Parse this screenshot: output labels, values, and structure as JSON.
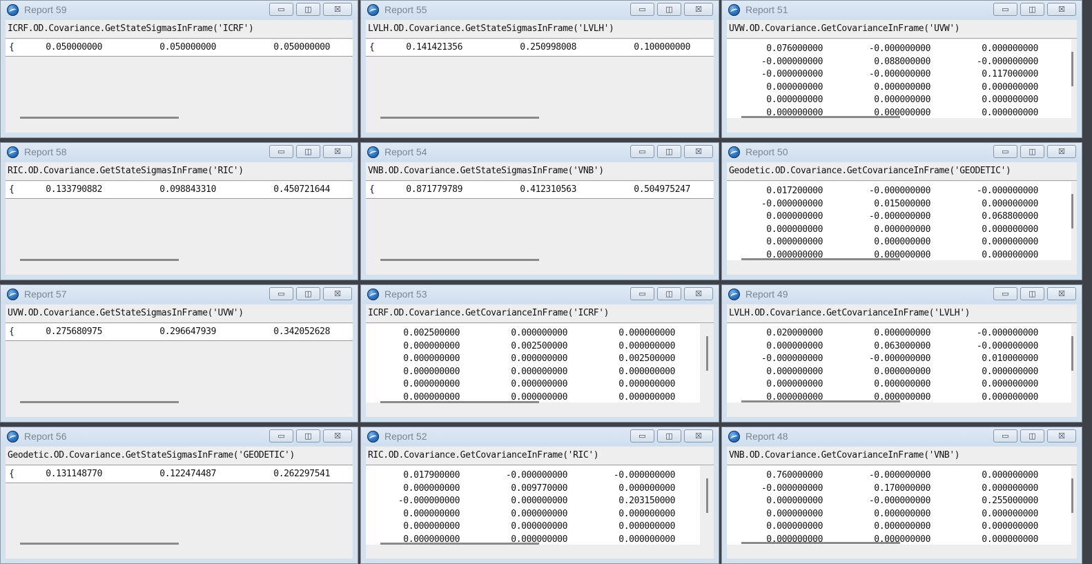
{
  "windows": [
    {
      "title": "Report 59",
      "expr": "ICRF.OD.Covariance.GetStateSigmasInFrame('ICRF')",
      "kind": "sigma",
      "values": [
        "0.050000000",
        "0.050000000",
        "0.050000000"
      ]
    },
    {
      "title": "Report 55",
      "expr": "LVLH.OD.Covariance.GetStateSigmasInFrame('LVLH')",
      "kind": "sigma",
      "values": [
        "0.141421356",
        "0.250998008",
        "0.100000000"
      ]
    },
    {
      "title": "Report 51",
      "expr": "UVW.OD.Covariance.GetCovarianceInFrame('UVW')",
      "kind": "matrix",
      "rows": [
        [
          "0.076000000",
          "-0.000000000",
          "0.000000000"
        ],
        [
          "-0.000000000",
          "0.088000000",
          "-0.000000000"
        ],
        [
          "-0.000000000",
          "-0.000000000",
          "0.117000000"
        ],
        [
          "0.000000000",
          "0.000000000",
          "0.000000000"
        ],
        [
          "0.000000000",
          "0.000000000",
          "0.000000000"
        ],
        [
          "0.000000000",
          "0.000000000",
          "0.000000000"
        ]
      ]
    },
    {
      "title": "Report 58",
      "expr": "RIC.OD.Covariance.GetStateSigmasInFrame('RIC')",
      "kind": "sigma",
      "values": [
        "0.133790882",
        "0.098843310",
        "0.450721644"
      ]
    },
    {
      "title": "Report 54",
      "expr": "VNB.OD.Covariance.GetStateSigmasInFrame('VNB')",
      "kind": "sigma",
      "values": [
        "0.871779789",
        "0.412310563",
        "0.504975247"
      ]
    },
    {
      "title": "Report 50",
      "expr": "Geodetic.OD.Covariance.GetCovarianceInFrame('GEODETIC')",
      "kind": "matrix",
      "rows": [
        [
          "0.017200000",
          "-0.000000000",
          "-0.000000000"
        ],
        [
          "-0.000000000",
          "0.015000000",
          "0.000000000"
        ],
        [
          "0.000000000",
          "-0.000000000",
          "0.068800000"
        ],
        [
          "0.000000000",
          "0.000000000",
          "0.000000000"
        ],
        [
          "0.000000000",
          "0.000000000",
          "0.000000000"
        ],
        [
          "0.000000000",
          "0.000000000",
          "0.000000000"
        ]
      ]
    },
    {
      "title": "Report 57",
      "expr": "UVW.OD.Covariance.GetStateSigmasInFrame('UVW')",
      "kind": "sigma",
      "values": [
        "0.275680975",
        "0.296647939",
        "0.342052628"
      ]
    },
    {
      "title": "Report 53",
      "expr": "ICRF.OD.Covariance.GetCovarianceInFrame('ICRF')",
      "kind": "matrix",
      "rows": [
        [
          "0.002500000",
          "0.000000000",
          "0.000000000"
        ],
        [
          "0.000000000",
          "0.002500000",
          "0.000000000"
        ],
        [
          "0.000000000",
          "0.000000000",
          "0.002500000"
        ],
        [
          "0.000000000",
          "0.000000000",
          "0.000000000"
        ],
        [
          "0.000000000",
          "0.000000000",
          "0.000000000"
        ],
        [
          "0.000000000",
          "0.000000000",
          "0.000000000"
        ]
      ]
    },
    {
      "title": "Report 49",
      "expr": "LVLH.OD.Covariance.GetCovarianceInFrame('LVLH')",
      "kind": "matrix",
      "rows": [
        [
          "0.020000000",
          "0.000000000",
          "-0.000000000"
        ],
        [
          "0.000000000",
          "0.063000000",
          "-0.000000000"
        ],
        [
          "-0.000000000",
          "-0.000000000",
          "0.010000000"
        ],
        [
          "0.000000000",
          "0.000000000",
          "0.000000000"
        ],
        [
          "0.000000000",
          "0.000000000",
          "0.000000000"
        ],
        [
          "0.000000000",
          "0.000000000",
          "0.000000000"
        ]
      ]
    },
    {
      "title": "Report 56",
      "expr": "Geodetic.OD.Covariance.GetStateSigmasInFrame('GEODETIC')",
      "kind": "sigma",
      "values": [
        "0.131148770",
        "0.122474487",
        "0.262297541"
      ]
    },
    {
      "title": "Report 52",
      "expr": "RIC.OD.Covariance.GetCovarianceInFrame('RIC')",
      "kind": "matrix",
      "rows": [
        [
          "0.017900000",
          "-0.000000000",
          "-0.000000000"
        ],
        [
          "0.000000000",
          "0.009770000",
          "0.000000000"
        ],
        [
          "-0.000000000",
          "0.000000000",
          "0.203150000"
        ],
        [
          "0.000000000",
          "0.000000000",
          "0.000000000"
        ],
        [
          "0.000000000",
          "0.000000000",
          "0.000000000"
        ],
        [
          "0.000000000",
          "0.000000000",
          "0.000000000"
        ]
      ]
    },
    {
      "title": "Report 48",
      "expr": "VNB.OD.Covariance.GetCovarianceInFrame('VNB')",
      "kind": "matrix",
      "rows": [
        [
          "0.760000000",
          "-0.000000000",
          "0.000000000"
        ],
        [
          "-0.000000000",
          "0.170000000",
          "0.000000000"
        ],
        [
          "0.000000000",
          "-0.000000000",
          "0.255000000"
        ],
        [
          "0.000000000",
          "0.000000000",
          "0.000000000"
        ],
        [
          "0.000000000",
          "0.000000000",
          "0.000000000"
        ],
        [
          "0.000000000",
          "0.000000000",
          "0.000000000"
        ]
      ]
    }
  ],
  "controls": {
    "minimize": "▭",
    "maximize": "◫",
    "close": "☒"
  },
  "sigma_prefix": "{",
  "colors": {
    "titlebar": "#d3e1ef",
    "client": "#eeeeee",
    "desktop": "#3e4147"
  }
}
